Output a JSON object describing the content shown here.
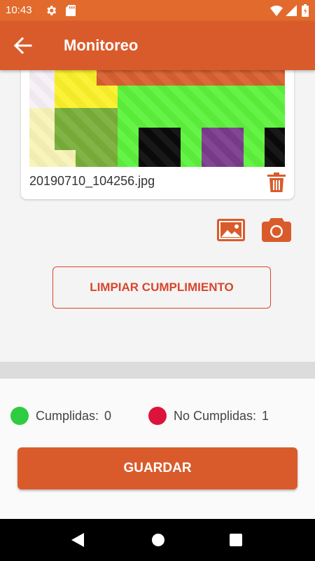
{
  "status_bar": {
    "time": "10:43"
  },
  "app_bar": {
    "title": "Monitoreo"
  },
  "attachment": {
    "filename": "20190710_104256.jpg"
  },
  "buttons": {
    "clear_label": "LIMPIAR CUMPLIMIENTO",
    "save_label": "GUARDAR"
  },
  "summary": {
    "fulfilled_label": "Cumplidas:",
    "fulfilled_value": "0",
    "unfulfilled_label": "No Cumplidas:",
    "unfulfilled_value": "1"
  },
  "colors": {
    "primary": "#d95b2b",
    "status_bar": "#e26a2c",
    "fulfilled_dot": "#2ecc40",
    "unfulfilled_dot": "#dc143c"
  },
  "icons": [
    "gear-icon",
    "sd-card-icon",
    "wifi-icon",
    "signal-icon",
    "battery-icon",
    "back-arrow-icon",
    "trash-icon",
    "gallery-icon",
    "camera-icon",
    "nav-back-icon",
    "nav-home-icon",
    "nav-recents-icon"
  ]
}
